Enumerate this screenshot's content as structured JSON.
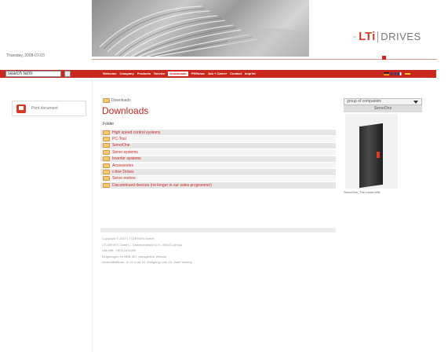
{
  "header": {
    "date": "Thursday, 2008-07-03",
    "logo": {
      "small": "LTI",
      "brand": "LTi",
      "product": "DRIVES"
    }
  },
  "search": {
    "placeholder": "search term"
  },
  "nav": {
    "items": [
      "Welcome",
      "Company",
      "Products",
      "Service",
      "Downloads",
      "PR/News",
      "Job + Career",
      "Contact",
      "Imprint"
    ],
    "active": "Downloads"
  },
  "sidebar": {
    "print_label": "Print document"
  },
  "main": {
    "breadcrumb": "Downloads",
    "title": "Downloads",
    "column_header": "Folder",
    "folders": [
      "High speed control systems",
      "PC-Tool",
      "ServoOne",
      "Servo systems",
      "Inverter systems",
      "Accessories",
      "c-line Drives",
      "Servo motors",
      "Discontinued devices (no longer in our sales programme)"
    ]
  },
  "footer": {
    "lines": [
      "Copyright © 2007 LTI DRIVES GmbH",
      "LTI DRIVES GmbH – Gewerbestraße 5-9 • 35633 Lahnau",
      "Ust-IdNr.: DE112631090",
      "Eingetragen im HRB 467, Amtsgericht Wetzlar",
      "Geschäftsführer: H.-H. Lust, Dr. Wolfgang Lust, Dr. Josef Irlesing"
    ]
  },
  "right_panel": {
    "select_value": "group of companies",
    "header": "ServoOne",
    "caption": "ServoOne_The name tells"
  },
  "colors": {
    "brand_red": "#c8281e",
    "accent_red": "#d63a27"
  }
}
